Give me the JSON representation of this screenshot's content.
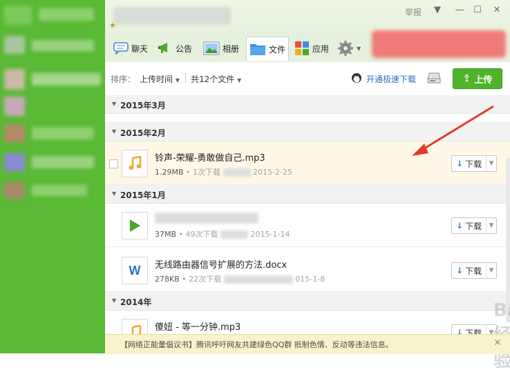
{
  "window": {
    "report_label": "举报",
    "controls": [
      "▼",
      "—",
      "☐",
      "✕"
    ]
  },
  "tabs": [
    {
      "label": "聊天",
      "icon": "chat-icon"
    },
    {
      "label": "公告",
      "icon": "announce-icon"
    },
    {
      "label": "相册",
      "icon": "photo-icon"
    },
    {
      "label": "文件",
      "icon": "folder-icon"
    },
    {
      "label": "应用",
      "icon": "apps-icon"
    }
  ],
  "toolbar": {
    "sort_label": "排序：",
    "sort_value": "上传时间",
    "count_label": "共12个文件",
    "fast_download": "开通极速下载",
    "upload": "上传"
  },
  "groups": [
    {
      "label": "2015年3月"
    },
    {
      "label": "2015年2月"
    },
    {
      "label": "2015年1月"
    },
    {
      "label": "2014年"
    }
  ],
  "files": [
    {
      "name": "铃声-荣耀-勇敢做自己.mp3",
      "size": "1.29MB",
      "downloads": "1次下载",
      "date": "2015-2-25",
      "icon": "music-note-icon"
    },
    {
      "name": "",
      "size": "37MB",
      "downloads": "49次下载",
      "date": "2015-1-14",
      "icon": "play-icon"
    },
    {
      "name": "无线路由器信号扩展的方法.docx",
      "size": "278KB",
      "downloads": "22次下载",
      "date": "015-1-8",
      "icon": "word-doc-icon"
    },
    {
      "name": "傻妞 - 等一分钟.mp3",
      "size": "",
      "downloads": "",
      "date": "",
      "icon": "music-note-icon"
    }
  ],
  "download_label": "下载",
  "notice": "【网络正能量倡议书】腾讯呼吁网友共建绿色QQ群 抵制色情、反动等违法信息。",
  "watermark": "Bai经验"
}
